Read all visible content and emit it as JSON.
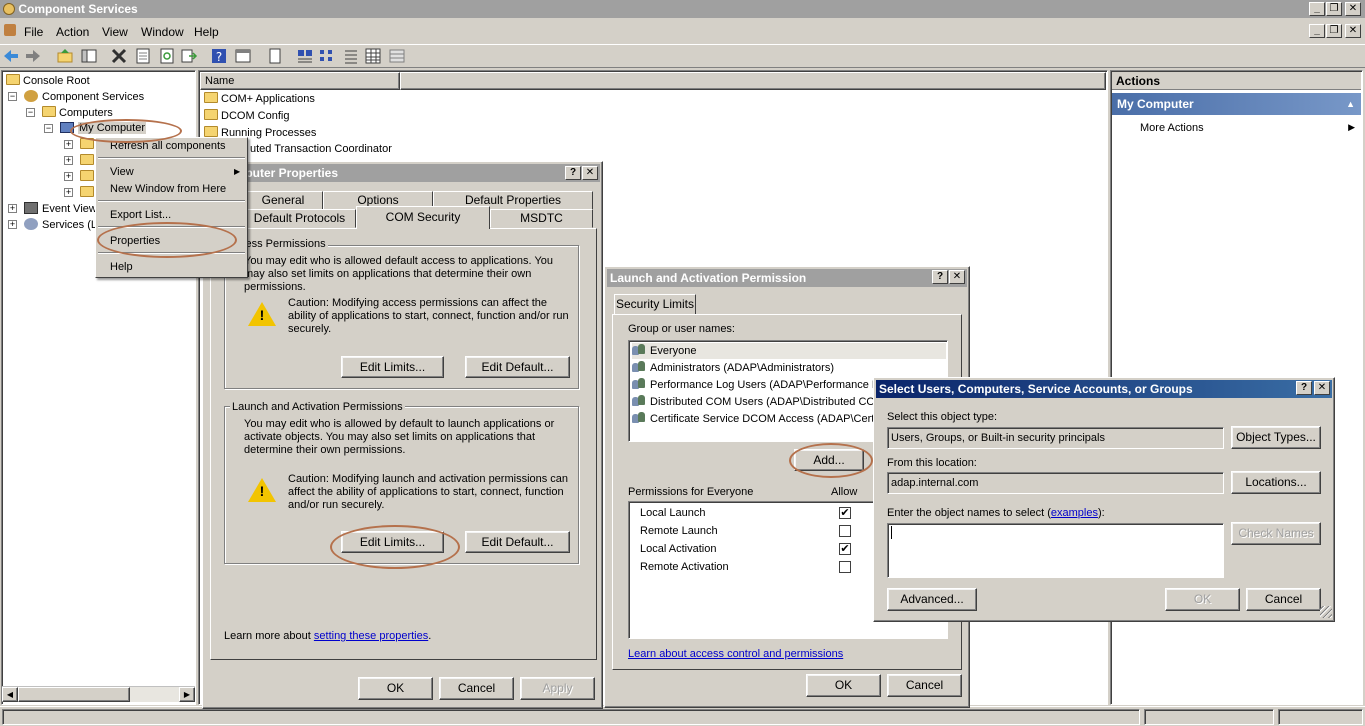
{
  "window": {
    "title": "Component Services"
  },
  "menubar": {
    "items": [
      "File",
      "Action",
      "View",
      "Window",
      "Help"
    ]
  },
  "tree": {
    "console_root": "Console Root",
    "component_services": "Component Services",
    "computers": "Computers",
    "my_computer": "My Computer",
    "event_viewer": "Event View",
    "services": "Services (L"
  },
  "list": {
    "header": "Name",
    "items": [
      "COM+ Applications",
      "DCOM Config",
      "Running Processes",
      "uted Transaction Coordinator"
    ]
  },
  "context_menu": {
    "items": [
      "Refresh all components",
      "View",
      "New Window from Here",
      "Export List...",
      "Properties",
      "Help"
    ]
  },
  "actions_pane": {
    "header": "Actions",
    "section": "My Computer",
    "more_actions": "More Actions"
  },
  "props_dialog": {
    "title": "nputer Properties",
    "tabs_back": [
      "General",
      "Options",
      "Default Properties"
    ],
    "tabs_front": [
      "Default Protocols",
      "COM Security",
      "MSDTC"
    ],
    "access_group": "cess Permissions",
    "access_text": "You may edit who is allowed default access to applications. You may also set limits on applications that determine their own permissions.",
    "access_caution": "Caution: Modifying access permissions can affect the ability of applications to start, connect, function and/or run securely.",
    "edit_limits": "Edit Limits...",
    "edit_default": "Edit Default...",
    "launch_group": "Launch and Activation Permissions",
    "launch_text": "You may edit who is allowed by default to launch applications or activate objects. You may also set limits on applications that determine their own permissions.",
    "launch_caution": "Caution: Modifying launch and activation permissions can affect the ability of applications to start, connect, function and/or run securely.",
    "learn_more_prefix": "Learn more about ",
    "learn_more_link": "setting these properties",
    "learn_more_suffix": ".",
    "ok": "OK",
    "cancel": "Cancel",
    "apply": "Apply"
  },
  "launch_dialog": {
    "title": "Launch and Activation Permission",
    "tab": "Security Limits",
    "group_label": "Group or user names:",
    "users": [
      "Everyone",
      "Administrators (ADAP\\Administrators)",
      "Performance Log Users (ADAP\\Performance L",
      "Distributed COM Users (ADAP\\Distributed COM",
      "Certificate Service DCOM Access (ADAP\\Certi"
    ],
    "add": "Add...",
    "perms_label": "Permissions for Everyone",
    "allow_label": "Allow",
    "permissions": [
      {
        "name": "Local Launch",
        "allow": "✔"
      },
      {
        "name": "Remote Launch",
        "allow": ""
      },
      {
        "name": "Local Activation",
        "allow": "✔"
      },
      {
        "name": "Remote Activation",
        "allow": ""
      }
    ],
    "learn_link": "Learn about access control and permissions",
    "ok": "OK",
    "cancel": "Cancel"
  },
  "select_dialog": {
    "title": "Select Users, Computers, Service Accounts, or Groups",
    "object_type_label": "Select this object type:",
    "object_type_value": "Users, Groups, or Built-in security principals",
    "object_types_button": "Object Types...",
    "location_label": "From this location:",
    "location_value": "adap.internal.com",
    "locations_button": "Locations...",
    "names_label_prefix": "Enter the object names to select (",
    "names_label_link": "examples",
    "names_label_suffix": "):",
    "names_value": "",
    "check_names": "Check Names",
    "advanced": "Advanced...",
    "ok": "OK",
    "cancel": "Cancel"
  },
  "icons": [
    "back-icon",
    "forward-icon",
    "up-folder-icon",
    "show-hide-tree-icon",
    "delete-icon",
    "properties-icon",
    "refresh-icon",
    "export-icon",
    "help-icon",
    "console-icon",
    "new-icon",
    "large-icons-icon",
    "small-icons-icon",
    "list-icon",
    "details-icon",
    "grid-icon",
    "caution-icon",
    "users-icon"
  ]
}
